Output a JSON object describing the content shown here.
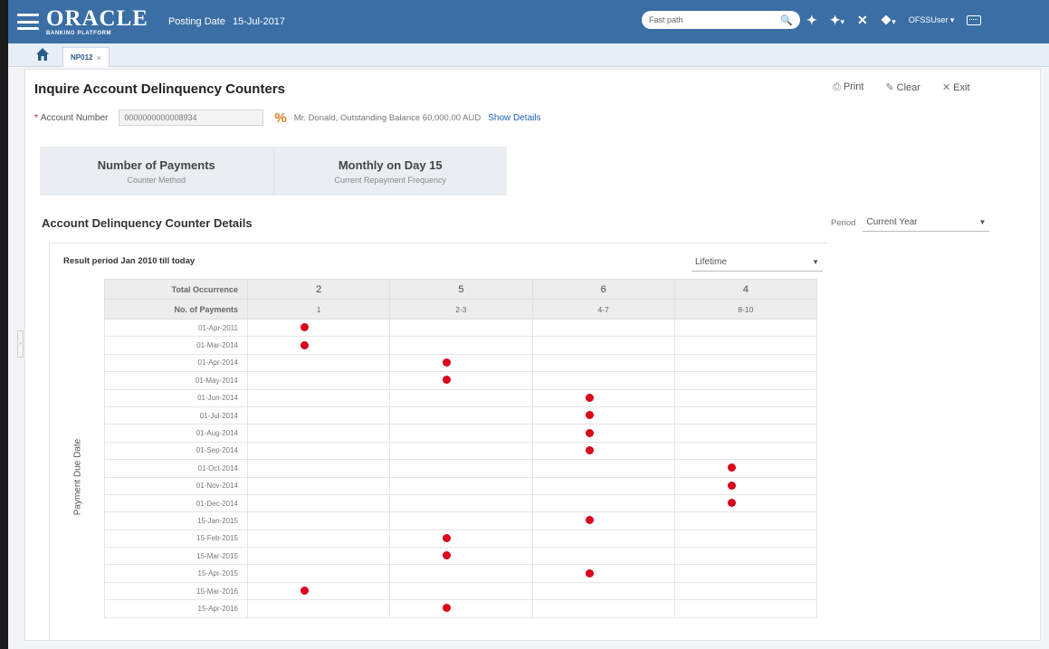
{
  "header": {
    "brand": "ORACLE",
    "brand_sub": "BANKING PLATFORM",
    "posting_label": "Posting Date",
    "posting_date": "15-Jul-2017",
    "fast_path_placeholder": "Fast path",
    "user": "OFSSUser"
  },
  "tabs": [
    {
      "label": "NP012"
    }
  ],
  "page": {
    "title": "Inquire Account Delinquency Counters",
    "actions": {
      "print": "Print",
      "clear": "Clear",
      "exit": "Exit"
    },
    "account_label": "Account Number",
    "account_value": "0000000000008934",
    "account_info": "Mr. Donald, Outstanding Balance 60,000.00 AUD",
    "show_details": "Show Details"
  },
  "summary": [
    {
      "value": "Number of Payments",
      "label": "Counter Method"
    },
    {
      "value": "Monthly on Day 15",
      "label": "Current Repayment Frequency"
    }
  ],
  "details": {
    "title": "Account Delinquency Counter Details",
    "period_label": "Period",
    "period_value": "Current Year",
    "result_title": "Result period Jan 2010 till today",
    "range_value": "Lifetime",
    "axis_label": "Payment Due Date"
  },
  "grid": {
    "row1_label": "Total Occurrence",
    "row2_label": "No. of Payments",
    "columns": [
      {
        "total": "2",
        "payments": "1"
      },
      {
        "total": "5",
        "payments": "2-3"
      },
      {
        "total": "6",
        "payments": "4-7"
      },
      {
        "total": "4",
        "payments": "8-10"
      }
    ],
    "rows": [
      {
        "date": "01-Apr-2011",
        "col": 0
      },
      {
        "date": "01-Mar-2014",
        "col": 0
      },
      {
        "date": "01-Apr-2014",
        "col": 1
      },
      {
        "date": "01-May-2014",
        "col": 1
      },
      {
        "date": "01-Jun-2014",
        "col": 2
      },
      {
        "date": "01-Jul-2014",
        "col": 2
      },
      {
        "date": "01-Aug-2014",
        "col": 2
      },
      {
        "date": "01-Sep-2014",
        "col": 2
      },
      {
        "date": "01-Oct-2014",
        "col": 3
      },
      {
        "date": "01-Nov-2014",
        "col": 3
      },
      {
        "date": "01-Dec-2014",
        "col": 3
      },
      {
        "date": "15-Jan-2015",
        "col": 2
      },
      {
        "date": "15-Feb-2015",
        "col": 1
      },
      {
        "date": "15-Mar-2015",
        "col": 1
      },
      {
        "date": "15-Apr-2015",
        "col": 2
      },
      {
        "date": "15-Mar-2016",
        "col": 0
      },
      {
        "date": "15-Apr-2016",
        "col": 1
      }
    ]
  },
  "colors": {
    "header_bg": "#3a6ea5",
    "marker": "#d9001b",
    "link": "#1d63b4"
  }
}
